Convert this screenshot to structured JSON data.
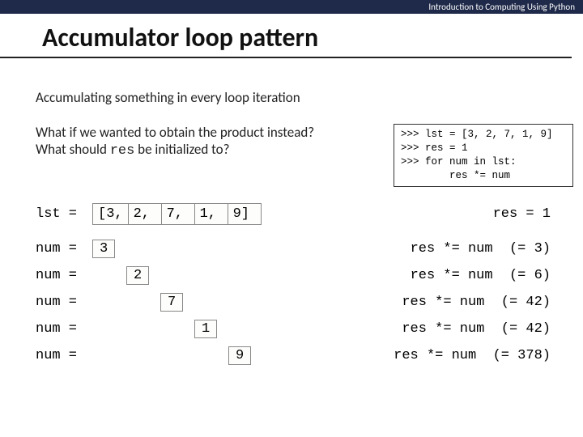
{
  "header": "Introduction to Computing Using Python",
  "title": "Accumulator loop pattern",
  "subtitle": "Accumulating something in every loop iteration",
  "question_line1": "What if we wanted to obtain the product instead?",
  "question_line2_a": "What should ",
  "question_line2_code": "res",
  "question_line2_b": " be initialized to?",
  "code_box": ">>> lst = [3, 2, 7, 1, 9]\n>>> res = 1\n>>> for num in lst:\n        res *= num",
  "lst_label": "lst =",
  "num_label": "num =",
  "list_cells": [
    "[3,",
    "2,",
    "7,",
    "1,",
    "9]"
  ],
  "res_init": "res = 1",
  "steps": [
    {
      "num": "3",
      "offset": 0,
      "rhs": "res *= num  (= 3)"
    },
    {
      "num": "2",
      "offset": 42,
      "rhs": "res *= num  (= 6)"
    },
    {
      "num": "7",
      "offset": 84,
      "rhs": "res *= num  (= 42)"
    },
    {
      "num": "1",
      "offset": 126,
      "rhs": "res *= num  (= 42)"
    },
    {
      "num": "9",
      "offset": 168,
      "rhs": "res *= num  (= 378)"
    }
  ]
}
